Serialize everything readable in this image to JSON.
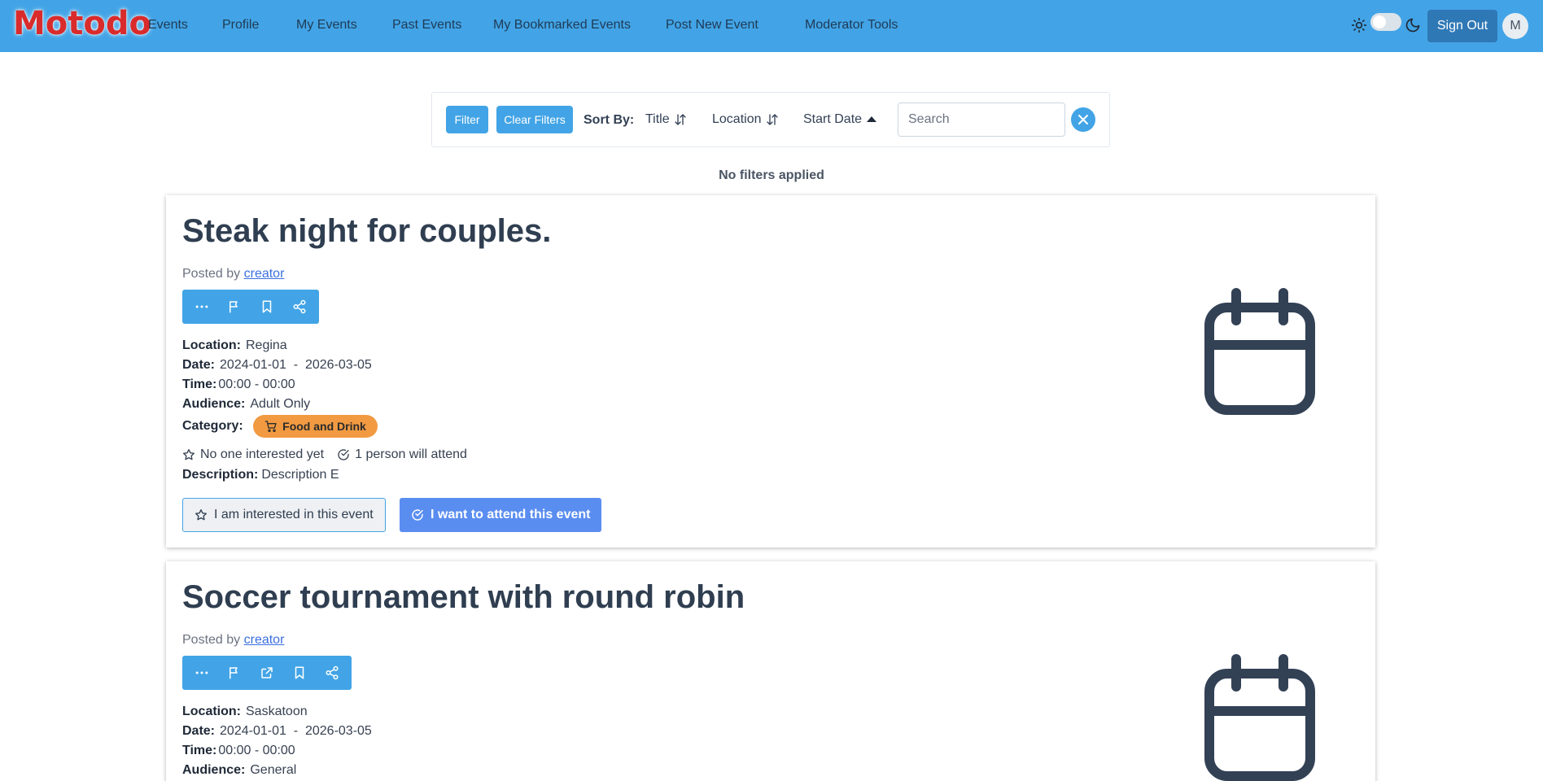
{
  "nav": {
    "logo": "Motodo",
    "links": [
      "Events",
      "Profile",
      "My Events",
      "Past Events",
      "My Bookmarked Events",
      "Post New Event",
      "Moderator Tools"
    ],
    "signout_label": "Sign Out",
    "avatar_initial": "M"
  },
  "filters": {
    "filter_label": "Filter",
    "clear_label": "Clear Filters",
    "sort_by_label": "Sort By:",
    "sort_options": [
      "Title",
      "Location",
      "Start Date"
    ],
    "search_placeholder": "Search",
    "status": "No filters applied"
  },
  "events": [
    {
      "title": "Steak night for couples.",
      "posted_by_prefix": "Posted by",
      "author": "creator",
      "location_label": "Location:",
      "location": "Regina",
      "date_label": "Date:",
      "date": "2024-01-01  -  2026-03-05",
      "time_label": "Time:",
      "time": "00:00 - 00:00",
      "audience_label": "Audience:",
      "audience": "Adult Only",
      "category_label": "Category:",
      "category": "Food and Drink",
      "interested_text": "No one interested yet",
      "attend_text": "1 person will attend",
      "description_label": "Description:",
      "description": "Description E",
      "interested_button": "I am interested in this event",
      "attend_button": "I want to attend this event"
    },
    {
      "title": "Soccer tournament with round robin",
      "posted_by_prefix": "Posted by",
      "author": "creator",
      "location_label": "Location:",
      "location": "Saskatoon",
      "date_label": "Date:",
      "date": "2024-01-01  -  2026-03-05",
      "time_label": "Time:",
      "time": "00:00 - 00:00",
      "audience_label": "Audience:",
      "audience": "General"
    }
  ],
  "colors": {
    "navbar": "#42a4e6",
    "primary_button": "#5a8df0",
    "category_badge": "#f19a42",
    "signout": "#2f78b6"
  }
}
